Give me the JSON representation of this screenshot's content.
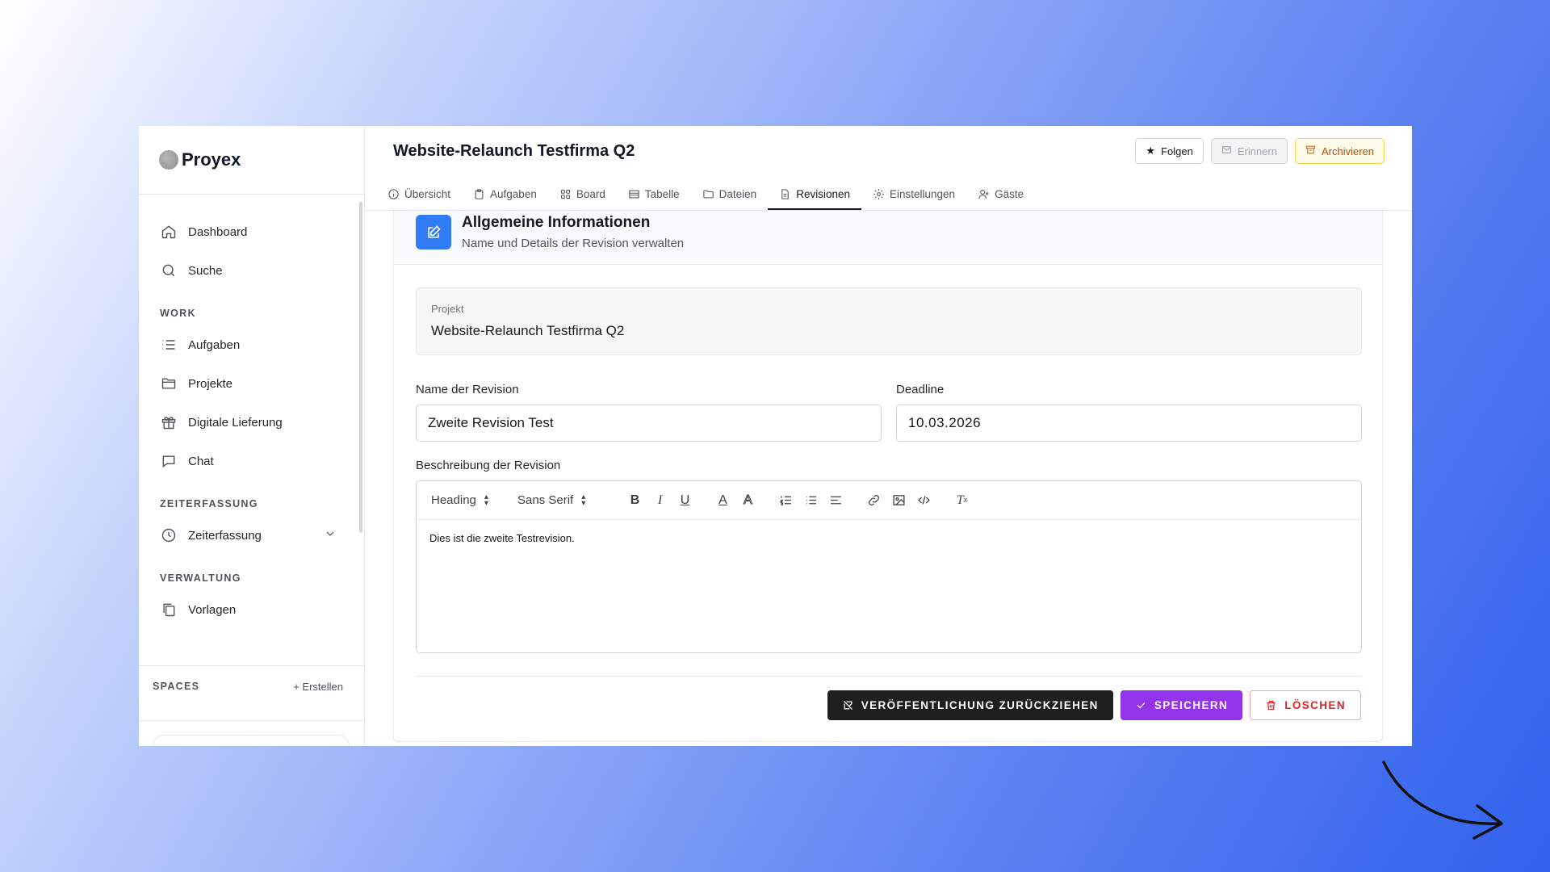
{
  "brand": {
    "name": "Proyex"
  },
  "sidebar": {
    "main_items": [
      {
        "label": "Dashboard",
        "icon": "home-icon"
      },
      {
        "label": "Suche",
        "icon": "search-icon"
      }
    ],
    "sections": [
      {
        "title": "WORK",
        "items": [
          {
            "label": "Aufgaben",
            "icon": "list-icon"
          },
          {
            "label": "Projekte",
            "icon": "folder-icon"
          },
          {
            "label": "Digitale Lieferung",
            "icon": "gift-icon"
          },
          {
            "label": "Chat",
            "icon": "chat-icon"
          }
        ]
      },
      {
        "title": "ZEITERFASSUNG",
        "items": [
          {
            "label": "Zeiterfassung",
            "icon": "clock-icon"
          }
        ]
      },
      {
        "title": "VERWALTUNG",
        "items": [
          {
            "label": "Vorlagen",
            "icon": "copy-icon"
          }
        ]
      }
    ],
    "spaces": {
      "title": "SPACES",
      "create": "+ Erstellen"
    }
  },
  "header": {
    "title": "Website-Relaunch Testfirma Q2",
    "actions": {
      "follow": "Folgen",
      "remind": "Erinnern",
      "archive": "Archivieren"
    }
  },
  "tabs": [
    {
      "label": "Übersicht",
      "icon": "info-icon"
    },
    {
      "label": "Aufgaben",
      "icon": "clipboard-icon"
    },
    {
      "label": "Board",
      "icon": "grid-icon"
    },
    {
      "label": "Tabelle",
      "icon": "table-icon"
    },
    {
      "label": "Dateien",
      "icon": "folder-icon"
    },
    {
      "label": "Revisionen",
      "icon": "document-icon",
      "active": true
    },
    {
      "label": "Einstellungen",
      "icon": "gear-icon"
    },
    {
      "label": "Gäste",
      "icon": "user-plus-icon"
    }
  ],
  "card": {
    "title": "Allgemeine Informationen",
    "subtitle": "Name und Details der Revision verwalten",
    "project": {
      "label": "Projekt",
      "value": "Website-Relaunch Testfirma Q2"
    },
    "revision_name": {
      "label": "Name der Revision",
      "value": "Zweite Revision Test"
    },
    "deadline": {
      "label": "Deadline",
      "value": "10.03.2026"
    },
    "description": {
      "label": "Beschreibung der Revision",
      "heading_select": "Heading",
      "font_select": "Sans Serif",
      "content": "Dies ist die zweite Testrevision."
    }
  },
  "footer": {
    "unpublish": "VERÖFFENTLICHUNG ZURÜCKZIEHEN",
    "save": "SPEICHERN",
    "delete": "LÖSCHEN"
  },
  "colors": {
    "accent_blue": "#2f7cf6",
    "save_purple": "#9333ea",
    "delete_red": "#dc2626",
    "archive_amber": "#b45309"
  }
}
